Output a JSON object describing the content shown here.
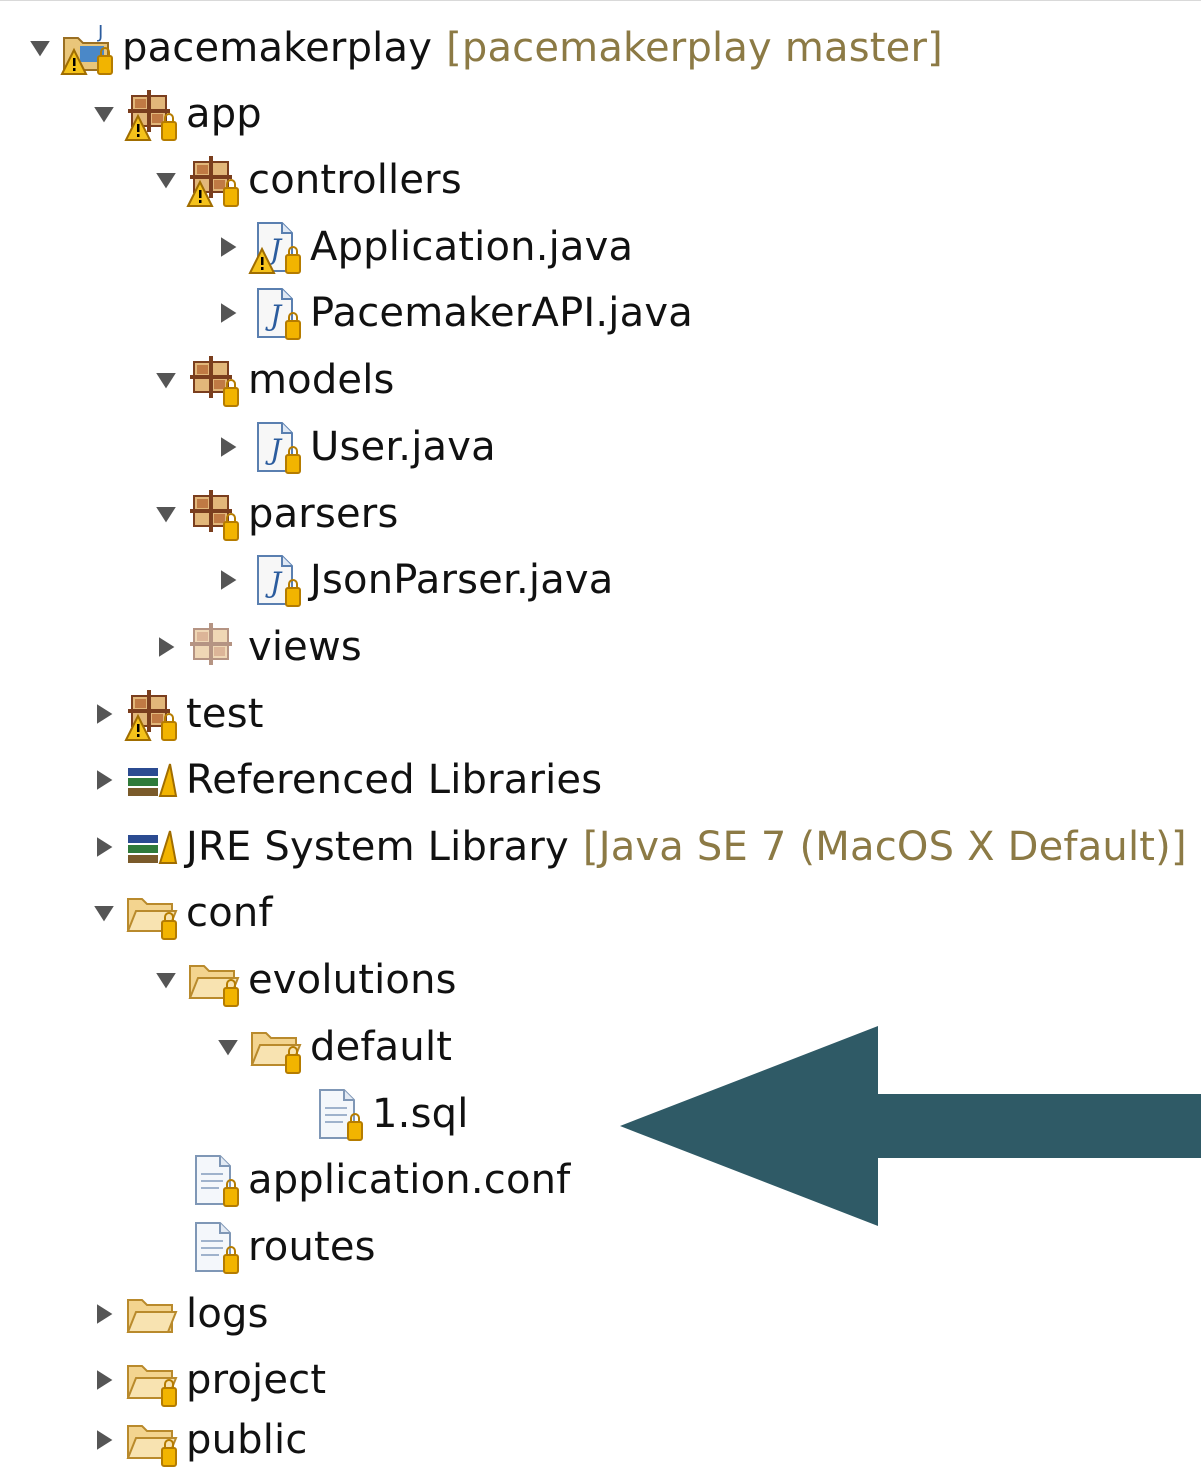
{
  "tree": {
    "project": {
      "name": "pacemakerplay",
      "decoration": "[pacemakerplay master]"
    },
    "app": "app",
    "controllers": "controllers",
    "application_java": "Application.java",
    "pacemakerapi_java": "PacemakerAPI.java",
    "models": "models",
    "user_java": "User.java",
    "parsers": "parsers",
    "jsonparser_java": "JsonParser.java",
    "views": "views",
    "test": "test",
    "referenced_libraries": "Referenced Libraries",
    "jre": {
      "name": "JRE System Library",
      "decoration": "[Java SE 7 (MacOS X Default)]"
    },
    "conf": "conf",
    "evolutions": "evolutions",
    "default": "default",
    "sql_1": "1.sql",
    "application_conf": "application.conf",
    "routes": "routes",
    "logs": "logs",
    "project_folder": "project",
    "public": "public"
  },
  "colors": {
    "arrow": "#2f5a66",
    "decoration_text": "#8c7a45",
    "folder_fill": "#f4d99a",
    "folder_stroke": "#b98a2c",
    "package_brown": "#8b4a2a",
    "library_green": "#2f7a3a",
    "library_blue": "#2a4a8a",
    "warning_yellow": "#f0b000"
  }
}
